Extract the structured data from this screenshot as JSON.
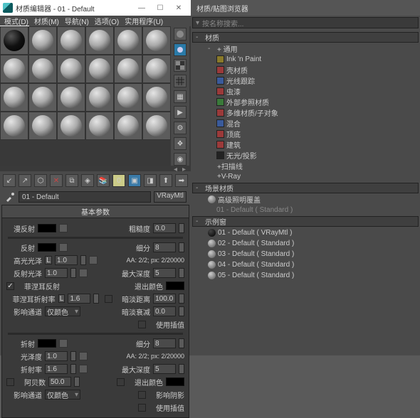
{
  "left": {
    "title": "材质编辑器 - 01 - Default",
    "menus": [
      "模式(D)",
      "材质(M)",
      "导航(N)",
      "选项(O)",
      "实用程序(U)"
    ],
    "material_name": "01 - Default",
    "material_type": "VRayMtl",
    "basic_group": "基本参数",
    "params": {
      "diffuse": "漫反射",
      "roughness": "粗糙度",
      "reflect": "反射",
      "subdiv": "细分",
      "hilight": "高光光泽",
      "aa": "AA: 2/2; px: 2/20000",
      "reflgloss": "反射光泽",
      "maxdepth": "最大深度",
      "fresnel": "菲涅耳反射",
      "exitcolor": "退出颜色",
      "fresnelior": "菲涅耳折射率",
      "dimdist": "暗淡距离",
      "affectchan": "影响通道",
      "dimfalloff": "暗淡衰减",
      "useinterp": "使用插值",
      "refract": "折射",
      "glossiness": "光泽度",
      "ior": "折射率",
      "abbe": "阿贝数",
      "affectshadow": "影响阴影",
      "chan_only": "仅颜色",
      "L": "L"
    },
    "values": {
      "roughness": "0.0",
      "subdiv": "8",
      "hilight": "1.0",
      "reflgloss": "1.0",
      "maxdepth": "5",
      "fresnelior": "1.6",
      "dimdist": "100.0",
      "dimfalloff": "0.0",
      "subdiv2": "8",
      "glossiness": "1.0",
      "maxdepth2": "5",
      "ior": "1.6",
      "abbe": "50.0"
    }
  },
  "right": {
    "title": "材质/贴图浏览器",
    "search_ph": "按名称搜索...",
    "tree": {
      "materials": "材质",
      "general": "+ 通用",
      "ink": "Ink 'n Paint",
      "items1": [
        "壳材质",
        "光线跟踪"
      ],
      "items1b": [
        "虫漆",
        "外部参照材质",
        "多维材质/子对象",
        "混合",
        "顶底",
        "建筑",
        "无光/投影"
      ],
      "items2": [
        "+扫描线",
        "+V-Ray"
      ],
      "scene": "场景材质",
      "scene_item": "高级照明覆盖",
      "scene_sub": "01 - Default ( Standard )",
      "samples": "示例窗",
      "list": [
        "01 - Default ( VRayMtl )",
        "02 - Default ( Standard )",
        "03 - Default ( Standard )",
        "04 - Default ( Standard )",
        "05 - Default ( Standard )"
      ]
    }
  }
}
